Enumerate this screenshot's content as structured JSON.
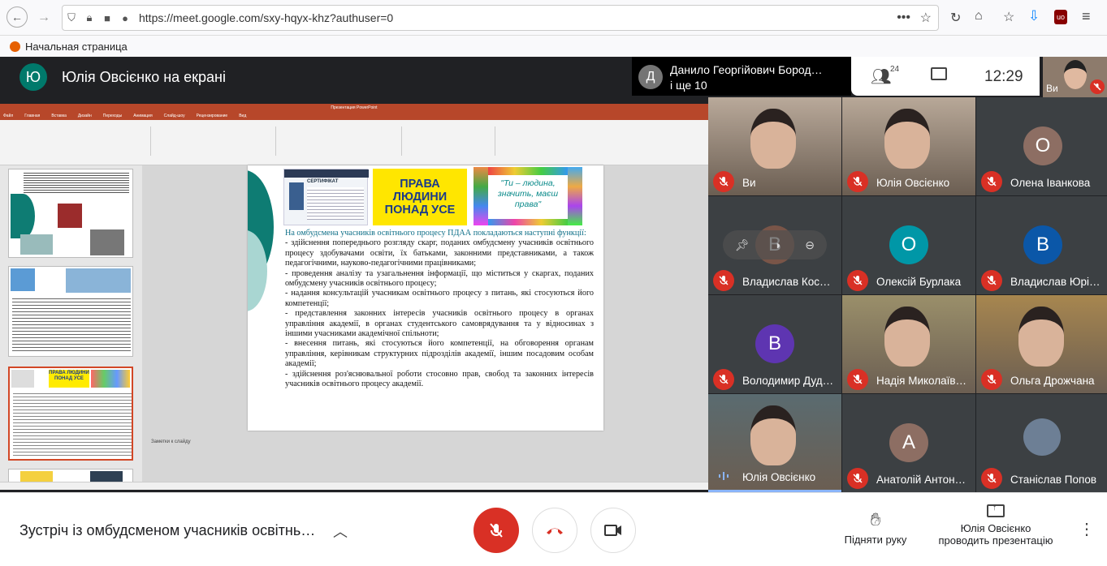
{
  "browser": {
    "url": "https://meet.google.com/sxy-hqyx-khz?authuser=0",
    "bookmark": "Начальная страница"
  },
  "meet": {
    "presenter_initial": "Ю",
    "presenter_title": "Юлія Овсієнко на екрані",
    "speaker_initial": "Д",
    "speaker_name": "Данило Георгійович Бород…",
    "speaker_more": "і ще 10",
    "people_count": "24",
    "time": "12:29",
    "self_label": "Ви"
  },
  "slide": {
    "cert_label": "СЕРТИФІКАТ",
    "banner_text": "ПРАВА ЛЮДИНИ ПОНАД УСЕ",
    "quote_text": "\"Ти – людина, значить, маєш права\"",
    "heading": "На омбудсмена учасників освітнього процесу ПДАА покладаються наступні функції:",
    "items": [
      "- здійснення попереднього розгляду скарг, поданих омбудсмену учасників освітнього процесу здобувачами освіти, їх батьками, законними представниками, а також педагогічними, науково-педагогічними працівниками;",
      "- проведення аналізу та узагальнення інформації, що міститься у скаргах, поданих омбудсмену учасників освітнього процесу;",
      " - надання консультацій учасникам освітнього процесу з питань, які стосуються його компетенції;",
      "- представлення законних інтересів учасників освітнього процесу в органах управління академії, в органах студентського самоврядування та у відносинах з іншими учасниками академічної спільноти;",
      "- внесення питань, які стосуються його компетенції, на обговорення органам управління, керівникам структурних підрозділів академії, іншим посадовим особам академії;",
      "- здійснення роз'яснювальної роботи стосовно прав, свобод та законних інтересів учасників освітнього процесу академії."
    ],
    "notes": "Заметки к слайду",
    "thumb2_banner": "ПРАВА ЛЮДИНИ ПОНАД УСЕ"
  },
  "participants": [
    {
      "name": "Ви",
      "type": "video",
      "tint": "#b9a99a"
    },
    {
      "name": "Юлія Овсієнко",
      "type": "video",
      "tint": "#b8a898"
    },
    {
      "name": "Олена Іванкова",
      "type": "avatar",
      "initial": "О",
      "color": "#8d6e63"
    },
    {
      "name": "Владислав Кос…",
      "type": "avatar-hover",
      "initial": "В",
      "color": "#795548"
    },
    {
      "name": "Олексій Бурлака",
      "type": "avatar",
      "initial": "О",
      "color": "#0097a7"
    },
    {
      "name": "Владислав Юрі…",
      "type": "avatar",
      "initial": "В",
      "color": "#0b57a8"
    },
    {
      "name": "Володимир Дуд…",
      "type": "avatar",
      "initial": "В",
      "color": "#5e35b1"
    },
    {
      "name": "Надія Миколаїв…",
      "type": "video",
      "tint": "#9a8f6a"
    },
    {
      "name": "Ольга Дрожчана",
      "type": "video",
      "tint": "#a7864f"
    },
    {
      "name": "Юлія Овсієнко",
      "type": "video-active",
      "tint": "#5a6b70"
    },
    {
      "name": "Анатолій Антон…",
      "type": "avatar",
      "initial": "А",
      "color": "#8d6e63"
    },
    {
      "name": "Станіслав Попов",
      "type": "photo",
      "color": "#6d7f95"
    }
  ],
  "bottom": {
    "meeting_title": "Зустріч із омбудсменом учасників освітнь…",
    "raise_hand": "Підняти руку",
    "presenting_name": "Юлія Овсієнко",
    "presenting_label": "проводить презентацію"
  }
}
